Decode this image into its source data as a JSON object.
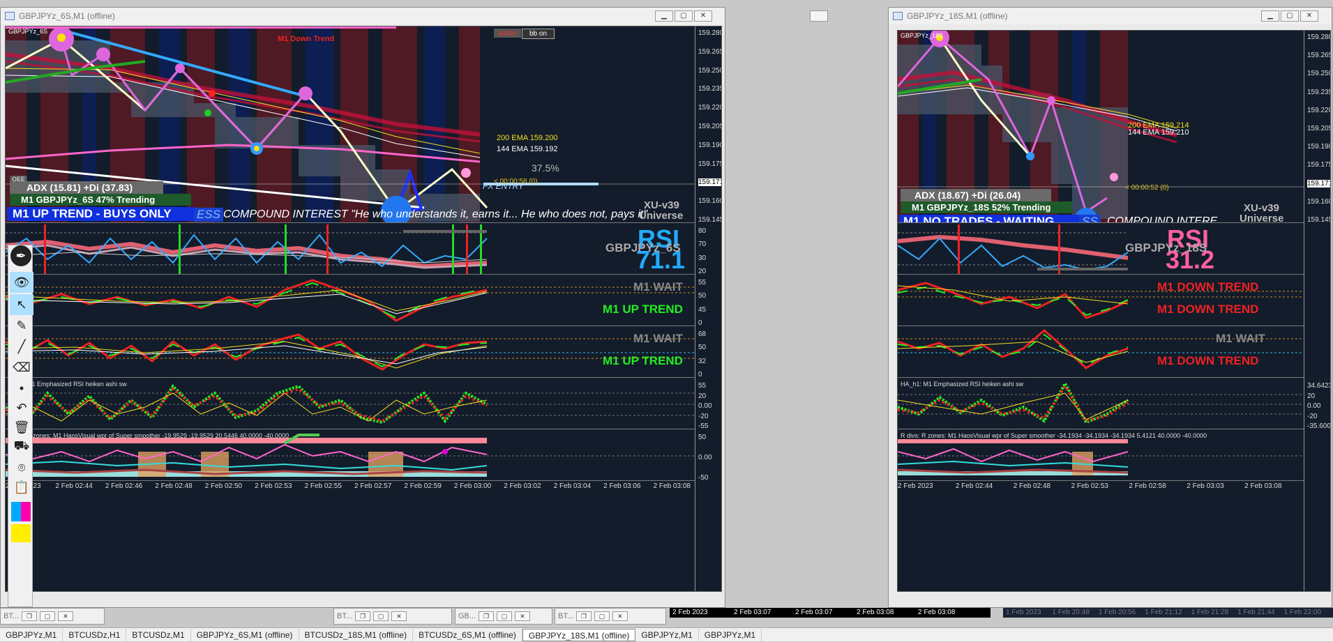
{
  "window_left": {
    "title": "GBPJPYz_6S,M1 (offline)",
    "symbol_tag": "GBPJPYz_6S",
    "price_axis": [
      "159.280",
      "159.265",
      "159.250",
      "159.235",
      "159.220",
      "159.205",
      "159.190",
      "159.175",
      "159.171",
      "159.160",
      "159.145"
    ],
    "current_price": "159.171",
    "trend_header": "M1 Down Trend",
    "guppy_label": "guppy",
    "bb_label": "bb on",
    "ema200": "200 EMA 159.200",
    "ema144": "144 EMA 159.192",
    "percent": "37.5%",
    "timer": "< 00:00:58 (0)",
    "fx_entry": "FX ENTRY",
    "adx": "ADX (15.81)    +Di (37.83)",
    "trending": "M1 GBPJPYz_6S 47% Trending",
    "banner": "M1 UP TREND - BUYS ONLY",
    "compound_prefix": "ESS",
    "compound": "COMPOUND INTEREST \"He who understands it, earns it... He who does not, pays it\"",
    "xu": "XU-v39",
    "universe": "Universe",
    "oee": "OEE",
    "rsi_label": "RSI",
    "rsi_value": "71.1",
    "rsi_symbol": "GBPJPYz_6S",
    "rsi_axis": [
      "80",
      "70",
      "30",
      "20"
    ],
    "pane3_wait": "M1 WAIT",
    "pane3_trend": "M1 UP TREND",
    "pane3_axis": [
      "55",
      "50",
      "45",
      "0"
    ],
    "pane4_wait": "M1 WAIT",
    "pane4_trend": "M1 UP TREND",
    "pane4_axis": [
      "68",
      "50",
      "32",
      "0"
    ],
    "pane5_title": "M1 Emphasized RSI heiken ashi sw",
    "pane5_axis": [
      "55",
      "20",
      "0.00",
      "-20",
      "-55"
    ],
    "pane6_title": "R zones: M1 HaosVisual wpr of Super smoother -19.9529 -19.9529 20.5446 40.0000 -40.0000",
    "pane6_axis": [
      "50",
      "0.00",
      "-50"
    ],
    "time_axis": [
      "2 Feb 2023",
      "2 Feb 02:44",
      "2 Feb 02:46",
      "2 Feb 02:48",
      "2 Feb 02:50",
      "2 Feb 02:53",
      "2 Feb 02:55",
      "2 Feb 02:57",
      "2 Feb 02:59",
      "2 Feb 03:00",
      "2 Feb 03:02",
      "2 Feb 03:04",
      "2 Feb 03:06",
      "2 Feb 03:08"
    ]
  },
  "window_right": {
    "title": "GBPJPYz_18S,M1 (offline)",
    "symbol_tag": "GBPJPYz_18S",
    "price_axis": [
      "159.280",
      "159.265",
      "159.250",
      "159.235",
      "159.220",
      "159.205",
      "159.190",
      "159.175",
      "159.171",
      "159.160",
      "159.145"
    ],
    "ema200": "200 EMA 159.214",
    "ema144": "144 EMA 159.210",
    "timer": "< 00:00:52 (0)",
    "adx": "ADX (18.67)    +Di (26.04)",
    "trending": "M1 GBPJPYz_18S 52% Trending",
    "banner": "M1  NO TRADES - WAITING . . .",
    "compound_prefix": "SS",
    "compound": "COMPOUND INTERE",
    "xu": "XU-v39",
    "universe": "Universe",
    "rsi_label": "RSI",
    "rsi_value": "31.2",
    "rsi_symbol": "GBPJPYz_18S",
    "pane3_wait": "M1 DOWN TREND",
    "pane3_trend": "M1 DOWN TREND",
    "pane4_wait": "M1 WAIT",
    "pane4_trend": "M1 DOWN TREND",
    "pane5_title": "HA_h1: M1 Emphasized RSI heiken ashi sw",
    "pane5_axis": [
      "34.6423",
      "20",
      "0.00",
      "-20",
      "-35.6000"
    ],
    "pane6_title": "R divs: R zones: M1 HaosVisual wpr of Super smoother -34.1934 -34.1934 -34.1934 5.4121 40.0000 -40.0000",
    "time_axis": [
      "2 Feb 2023",
      "2 Feb 02:44",
      "2 Feb 02:48",
      "2 Feb 02:53",
      "2 Feb 02:58",
      "2 Feb 03:03",
      "2 Feb 03:08"
    ]
  },
  "bottom_strip_left": [
    "2 Feb 2023",
    "2 Feb 03:07",
    "2 Feb 03:07",
    "2 Feb 03:08",
    "2 Feb 03:08"
  ],
  "bottom_strip_right": [
    "1 Feb 2023",
    "1 Feb 20:48",
    "1 Feb 20:56",
    "1 Feb 21:12",
    "1 Feb 21:28",
    "1 Feb 21:44",
    "1 Feb 22:00"
  ],
  "minimized": [
    "BT...",
    "BT...",
    "GB...",
    "BT..."
  ],
  "taskbar": [
    "GBPJPYz,M1",
    "BTCUSDz,H1",
    "BTCUSDz,M1",
    "GBPJPYz_6S,M1 (offline)",
    "BTCUSDz_18S,M1 (offline)",
    "BTCUSDz_6S,M1 (offline)",
    "GBPJPYz_18S,M1 (offline)",
    "GBPJPYz,M1",
    "GBPJPYz,M1"
  ],
  "colors": {
    "bg": "#131c2a",
    "up": "#22ee22",
    "down": "#ee2222",
    "pink": "#ff66cc",
    "cyan": "#33aaff"
  }
}
